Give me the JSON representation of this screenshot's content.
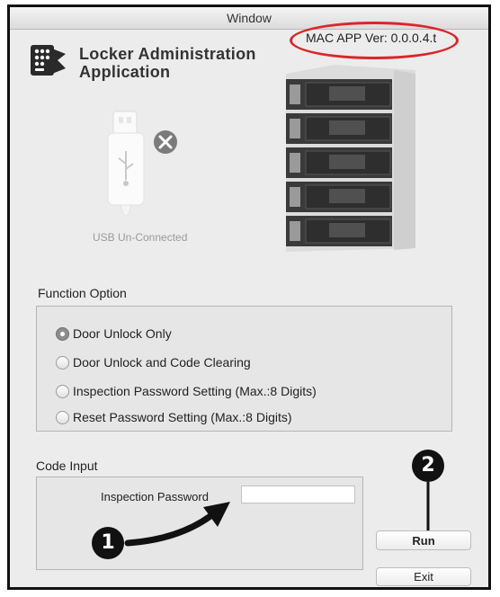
{
  "window": {
    "title": "Window"
  },
  "header": {
    "version": "MAC APP Ver: 0.0.0.4.t",
    "app_title_line1": "Locker Administration",
    "app_title_line2": "Application"
  },
  "usb": {
    "status": "USB Un-Connected",
    "icon": "usb-icon"
  },
  "function_option": {
    "label": "Function Option",
    "options": [
      {
        "label": "Door Unlock Only",
        "selected": true
      },
      {
        "label": "Door Unlock and Code Clearing",
        "selected": false
      },
      {
        "label": "Inspection Password Setting (Max.:8 Digits)",
        "selected": false
      },
      {
        "label": "Reset Password Setting (Max.:8 Digits)",
        "selected": false
      }
    ]
  },
  "code_input": {
    "label": "Code Input",
    "field_label": "Inspection Password",
    "value": "",
    "placeholder": ""
  },
  "buttons": {
    "run": "Run",
    "exit": "Exit"
  },
  "annotations": {
    "step1": "1",
    "step2": "2",
    "highlight_color": "#d9262a"
  }
}
